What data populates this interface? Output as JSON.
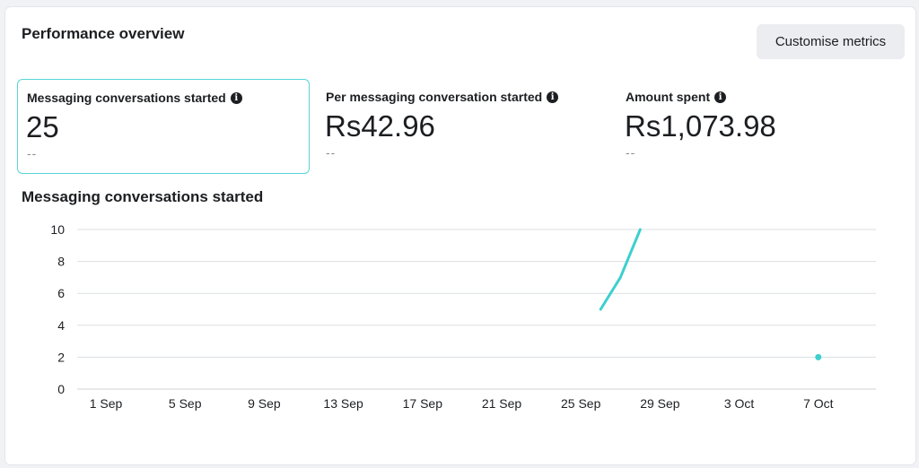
{
  "header": {
    "title": "Performance overview",
    "customise_label": "Customise metrics"
  },
  "metrics": [
    {
      "label": "Messaging conversations started",
      "value": "25",
      "delta": "--",
      "selected": true
    },
    {
      "label": "Per messaging conversation started",
      "value": "Rs42.96",
      "delta": "--",
      "selected": false
    },
    {
      "label": "Amount spent",
      "value": "Rs1,073.98",
      "delta": "--",
      "selected": false
    }
  ],
  "info_icon_name": "info-icon",
  "chart_title": "Messaging conversations started",
  "chart_data": {
    "type": "line",
    "title": "Messaging conversations started",
    "xlabel": "",
    "ylabel": "",
    "x_ticks": [
      "1 Sep",
      "5 Sep",
      "9 Sep",
      "13 Sep",
      "17 Sep",
      "21 Sep",
      "25 Sep",
      "29 Sep",
      "3 Oct",
      "7 Oct"
    ],
    "y_ticks": [
      0,
      2,
      4,
      6,
      8,
      10
    ],
    "ylim": [
      0,
      10
    ],
    "series": [
      {
        "color": "#3ecfcf",
        "points": [
          {
            "x": "26 Sep",
            "y": 5
          },
          {
            "x": "27 Sep",
            "y": 7
          },
          {
            "x": "28 Sep",
            "y": 10
          },
          {
            "x": "7 Oct",
            "y": 2
          }
        ]
      }
    ],
    "grid": true
  }
}
